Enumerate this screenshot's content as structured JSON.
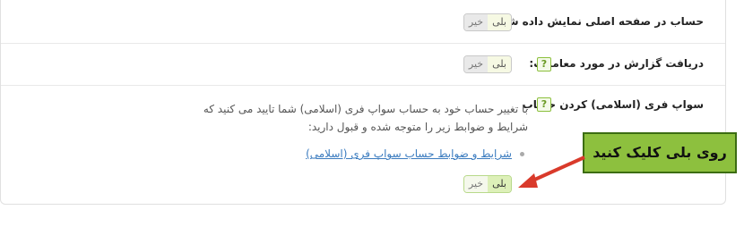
{
  "settings": {
    "show_on_home": {
      "label": "حساب در صفحه اصلی نمایش داده شود؟",
      "yes": "بلی",
      "no": "خیر"
    },
    "trade_reports": {
      "label": "دریافت گزارش در مورد معاملات:",
      "help": "?",
      "yes": "بلی",
      "no": "خیر"
    },
    "swap_free": {
      "label": "سواپ فری (اسلامی) کردن حساب",
      "help": "?",
      "description": "با تغییر حساب خود به حساب سواپ فری (اسلامی) شما تایید می کنید که شرایط و ضوابط زیر را متوجه شده و قبول دارید:",
      "link": "شرایط و ضوابط حساب سواپ فری (اسلامی)",
      "yes": "بلی",
      "no": "خیر"
    }
  },
  "annotation": {
    "text": "روی بلی کلیک کنید",
    "color": "#8dc03e",
    "arrow_color": "#d93a2b"
  }
}
